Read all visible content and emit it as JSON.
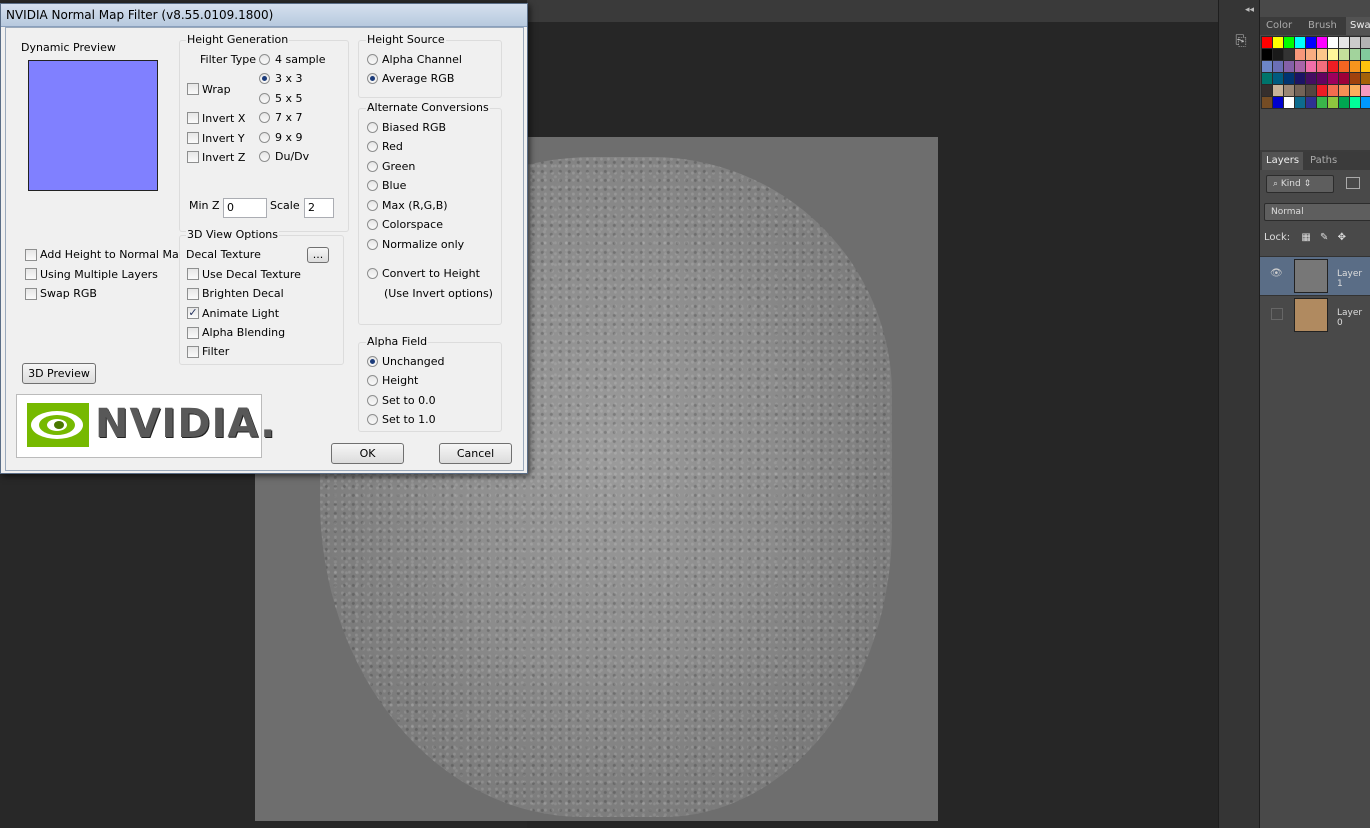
{
  "dialog": {
    "title": "NVIDIA Normal Map Filter (v8.55.0109.1800)",
    "dynamic_preview_label": "Dynamic Preview",
    "preview_color": "#8080ff",
    "height_generation": {
      "title": "Height Generation",
      "filter_type_label": "Filter Type",
      "filter_types": [
        "4 sample",
        "3 x 3",
        "5 x 5",
        "7 x 7",
        "9 x 9",
        "Du/Dv"
      ],
      "selected_filter": "3 x 3",
      "wrap_label": "Wrap",
      "invert_x_label": "Invert X",
      "invert_y_label": "Invert Y",
      "invert_z_label": "Invert Z",
      "min_z_label": "Min Z",
      "min_z_value": "0",
      "scale_label": "Scale",
      "scale_value": "2"
    },
    "left_options": {
      "add_height": "Add Height to Normal Map",
      "multiple_layers": "Using Multiple Layers",
      "swap_rgb": "Swap RGB"
    },
    "view_3d": {
      "title": "3D View Options",
      "decal_texture_label": "Decal Texture",
      "browse_label": "...",
      "use_decal": "Use Decal Texture",
      "brighten_decal": "Brighten Decal",
      "animate_light": "Animate Light",
      "alpha_blending": "Alpha Blending",
      "filter": "Filter"
    },
    "preview_3d_button": "3D Preview",
    "logo_text": "NVIDIA.",
    "height_source": {
      "title": "Height Source",
      "alpha_channel": "Alpha Channel",
      "average_rgb": "Average RGB"
    },
    "alt_conversions": {
      "title": "Alternate Conversions",
      "biased_rgb": "Biased RGB",
      "red": "Red",
      "green": "Green",
      "blue": "Blue",
      "max_rgb": "Max (R,G,B)",
      "colorspace": "Colorspace",
      "normalize_only": "Normalize only",
      "convert_to_height": "Convert to Height",
      "invert_note": "(Use Invert options)"
    },
    "alpha_field": {
      "title": "Alpha Field",
      "unchanged": "Unchanged",
      "height": "Height",
      "set_0": "Set to 0.0",
      "set_1": "Set to 1.0"
    },
    "ok_label": "OK",
    "cancel_label": "Cancel"
  },
  "photoshop": {
    "collapse_icon": "double-chevron-left-icon",
    "panel_tabs": [
      "Color",
      "Brush",
      "Swa"
    ],
    "swatch_colors": [
      "#ff0000",
      "#ffff00",
      "#00ff00",
      "#00ffff",
      "#0000ff",
      "#ff00ff",
      "#ffffff",
      "#e6e6e6",
      "#cccccc",
      "#b3b3b3",
      "#000000",
      "#1a1a1a",
      "#333333",
      "#f7977a",
      "#f9ad81",
      "#fdc68a",
      "#fff79a",
      "#c4df9b",
      "#a2d39c",
      "#82ca9d",
      "#6d86c7",
      "#6b6fb6",
      "#8560a8",
      "#a864a8",
      "#f06ea9",
      "#f26d7d",
      "#ee1d23",
      "#f26522",
      "#f7941d",
      "#ffc20e",
      "#00746b",
      "#005b7f",
      "#003471",
      "#1b1464",
      "#440e62",
      "#630460",
      "#9e005d",
      "#9e0039",
      "#a0410d",
      "#a36209",
      "#362f2d",
      "#c7b299",
      "#998675",
      "#736357",
      "#534741",
      "#ed1c24",
      "#f26c4f",
      "#f68e55",
      "#fbaf5d",
      "#f49ac1",
      "#754c24",
      "#0000cc",
      "#ffffff",
      "#0d6b8e",
      "#2e3192",
      "#39b54a",
      "#8dc63f",
      "#00a651",
      "#00ff99",
      "#0099ff"
    ],
    "layers_tabs": [
      "Layers",
      "Paths"
    ],
    "kind_label": "Kind",
    "blend_mode": "Normal",
    "lock_label": "Lock:",
    "layers": [
      {
        "name": "Layer 1",
        "visible": true
      },
      {
        "name": "Layer 0",
        "visible": false
      }
    ]
  }
}
